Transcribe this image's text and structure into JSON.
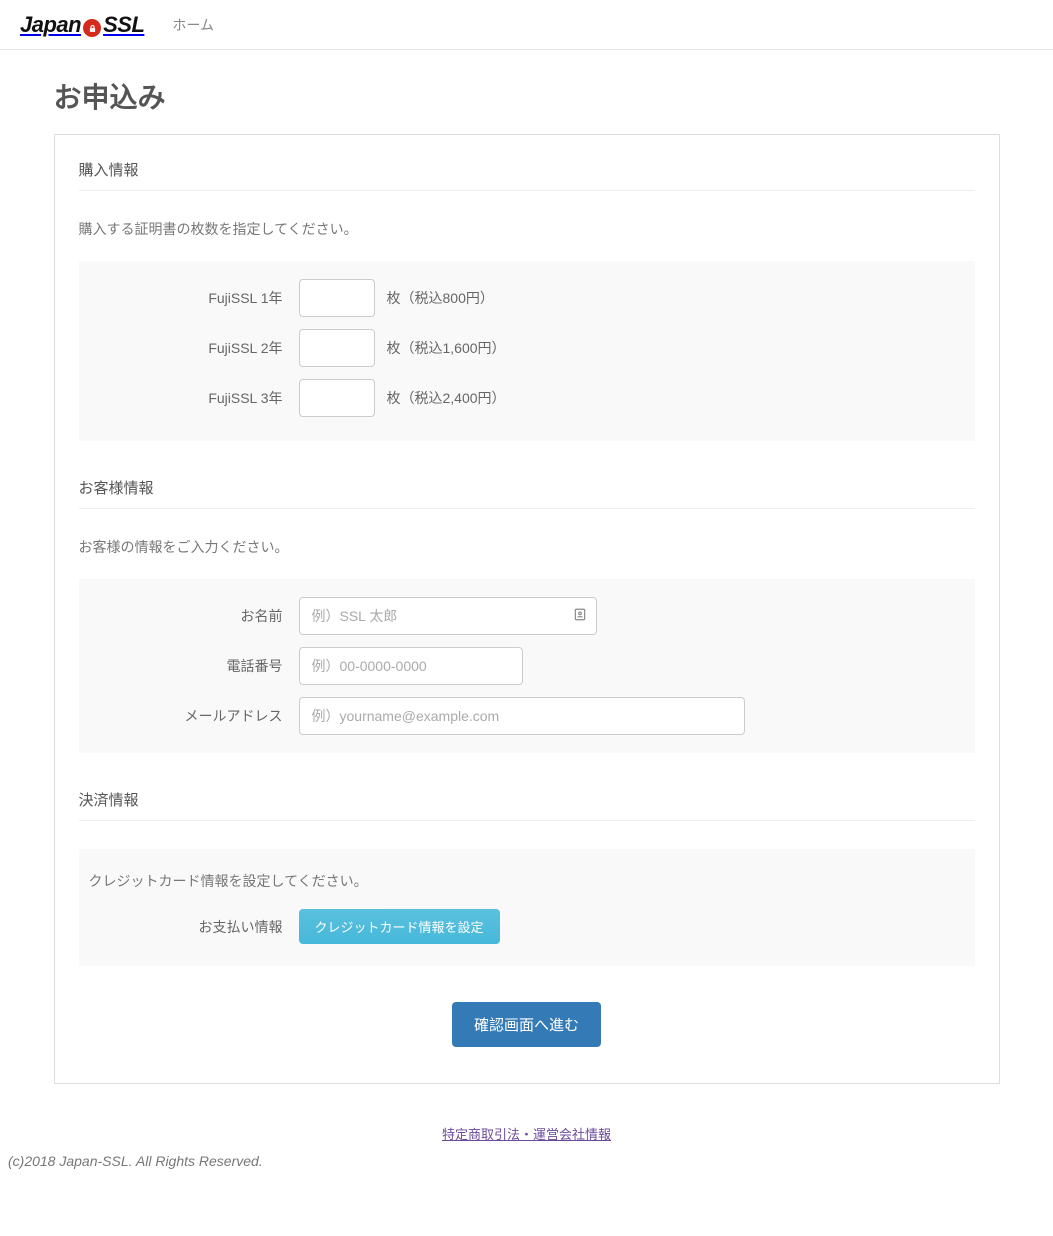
{
  "nav": {
    "logo_japan": "Japan",
    "logo_ssl": "SSL",
    "home": "ホーム"
  },
  "page": {
    "title": "お申込み"
  },
  "purchase": {
    "heading": "購入情報",
    "desc": "購入する証明書の枚数を指定してください。",
    "items": [
      {
        "label": "FujiSSL 1年",
        "unit_price": "枚（税込800円）"
      },
      {
        "label": "FujiSSL 2年",
        "unit_price": "枚（税込1,600円）"
      },
      {
        "label": "FujiSSL 3年",
        "unit_price": "枚（税込2,400円）"
      }
    ]
  },
  "customer": {
    "heading": "お客様情報",
    "desc": "お客様の情報をご入力ください。",
    "name_label": "お名前",
    "name_placeholder": "例）SSL 太郎",
    "phone_label": "電話番号",
    "phone_placeholder": "例）00-0000-0000",
    "email_label": "メールアドレス",
    "email_placeholder": "例）yourname@example.com"
  },
  "payment": {
    "heading": "決済情報",
    "desc": "クレジットカード情報を設定してください。",
    "label": "お支払い情報",
    "button": "クレジットカード情報を設定"
  },
  "submit": {
    "button": "確認画面へ進む"
  },
  "footer": {
    "law_link": "特定商取引法・運営会社情報",
    "copyright": "(c)2018 Japan-SSL. All Rights Reserved."
  }
}
